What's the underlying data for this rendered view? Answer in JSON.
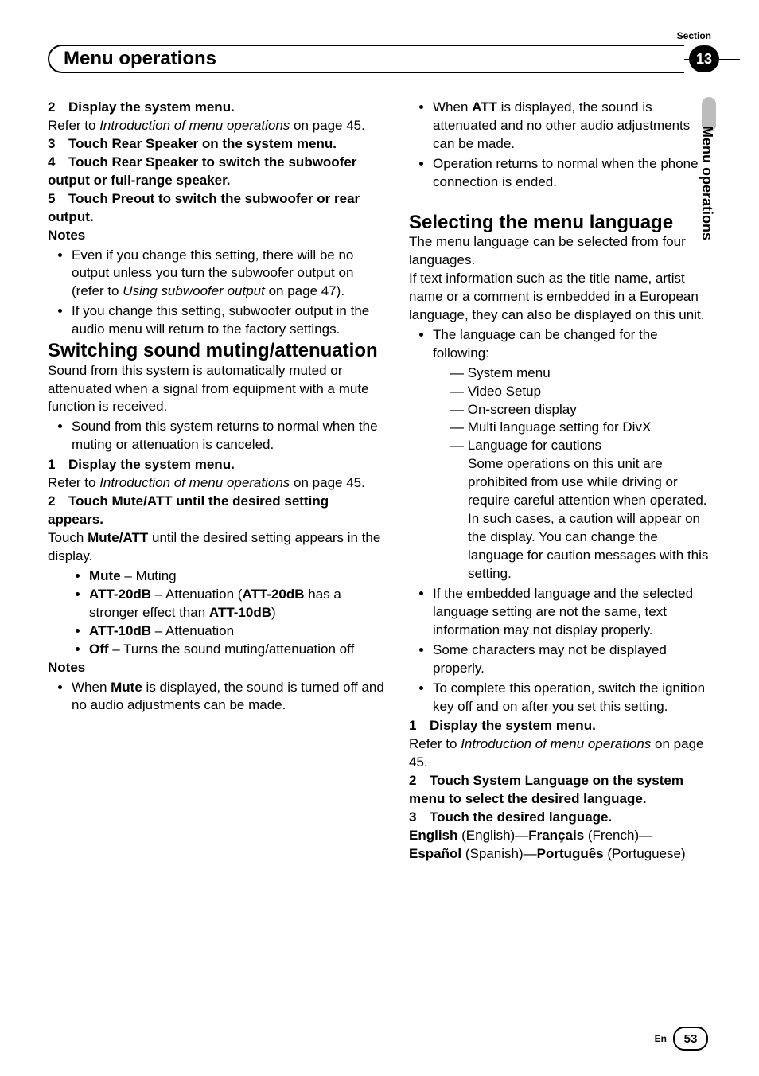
{
  "header": {
    "section_label": "Section",
    "title": "Menu operations",
    "badge": "13",
    "side_label": "Menu operations"
  },
  "left": {
    "step2": {
      "num": "2",
      "title": "Display the system menu."
    },
    "step2_ref_a": "Refer to ",
    "step2_ref_i": "Introduction of menu operations",
    "step2_ref_b": " on page 45.",
    "step3": {
      "num": "3",
      "title": "Touch Rear Speaker on the system menu."
    },
    "step4": {
      "num": "4",
      "title": "Touch Rear Speaker to switch the subwoofer output or full-range speaker."
    },
    "step5": {
      "num": "5",
      "title": "Touch Preout to switch the subwoofer or rear output."
    },
    "notes_label": "Notes",
    "note1_a": "Even if you change this setting, there will be no output unless you turn the subwoofer output on (refer to ",
    "note1_i": "Using subwoofer output",
    "note1_b": " on page 47).",
    "note2": "If you change this setting, subwoofer output in the audio menu will return to the factory settings.",
    "sub1_title": "Switching sound muting/attenuation",
    "sub1_intro": "Sound from this system is automatically muted or attenuated when a signal from equipment with a mute function is received.",
    "sub1_b1": "Sound from this system returns to normal when the muting or attenuation is canceled.",
    "s1_step1": {
      "num": "1",
      "title": "Display the system menu."
    },
    "s1_step1_ref_a": "Refer to ",
    "s1_step1_ref_i": "Introduction of menu operations",
    "s1_step1_ref_b": " on page 45.",
    "s1_step2": {
      "num": "2",
      "title": "Touch Mute/ATT until the desired setting appears."
    },
    "s1_step2_body_a": "Touch ",
    "s1_step2_body_b": "Mute/ATT",
    "s1_step2_body_c": " until the desired setting appears in the display.",
    "opt_mute_b": "Mute",
    "opt_mute_t": " – Muting",
    "opt_att20_b": "ATT-20dB",
    "opt_att20_t1": " – Attenuation (",
    "opt_att20_b2": "ATT-20dB",
    "opt_att20_t2": " has a stronger effect than ",
    "opt_att20_b3": "ATT-10dB",
    "opt_att20_t3": ")",
    "opt_att10_b": "ATT-10dB",
    "opt_att10_t": " – Attenuation",
    "opt_off_b": "Off",
    "opt_off_t": " – Turns the sound muting/attenuation off",
    "notes2_label": "Notes",
    "note2_1a": "When ",
    "note2_1b": "Mute",
    "note2_1c": " is displayed, the sound is turned off and no audio adjustments can be made."
  },
  "right": {
    "cont1a": "When ",
    "cont1b": "ATT",
    "cont1c": " is displayed, the sound is attenuated and no other audio adjustments can be made.",
    "cont2": "Operation returns to normal when the phone connection is ended.",
    "sub2_title": "Selecting the menu language",
    "sub2_p1": "The menu language can be selected from four languages.",
    "sub2_p2": "If text information such as the title name, artist name or a comment is embedded in a European language, they can also be displayed on this unit.",
    "b1": "The language can be changed for the following:",
    "d1": "System menu",
    "d2": "Video Setup",
    "d3": "On-screen display",
    "d4": "Multi language setting for DivX",
    "d5": "Language for cautions",
    "d5_body": "Some operations on this unit are prohibited from use while driving or require careful attention when operated. In such cases, a caution will appear on the display. You can change the language for caution messages with this setting.",
    "b2": "If the embedded language and the selected language setting are not the same, text information may not display properly.",
    "b3": "Some characters may not be displayed properly.",
    "b4": "To complete this operation, switch the ignition key off and on after you set this setting.",
    "s2_step1": {
      "num": "1",
      "title": "Display the system menu."
    },
    "s2_step1_ref_a": "Refer to ",
    "s2_step1_ref_i": "Introduction of menu operations",
    "s2_step1_ref_b": " on page 45.",
    "s2_step2": {
      "num": "2",
      "title": "Touch System Language on the system menu to select the desired language."
    },
    "s2_step3": {
      "num": "3",
      "title": "Touch the desired language."
    },
    "langs_en_b": "English",
    "langs_en_t": " (English)—",
    "langs_fr_b": "Français",
    "langs_fr_t": " (French)—",
    "langs_es_b": "Español",
    "langs_es_t": " (Spanish)—",
    "langs_pt_b": "Português",
    "langs_pt_t": " (Portuguese)"
  },
  "footer": {
    "lang": "En",
    "page": "53"
  }
}
